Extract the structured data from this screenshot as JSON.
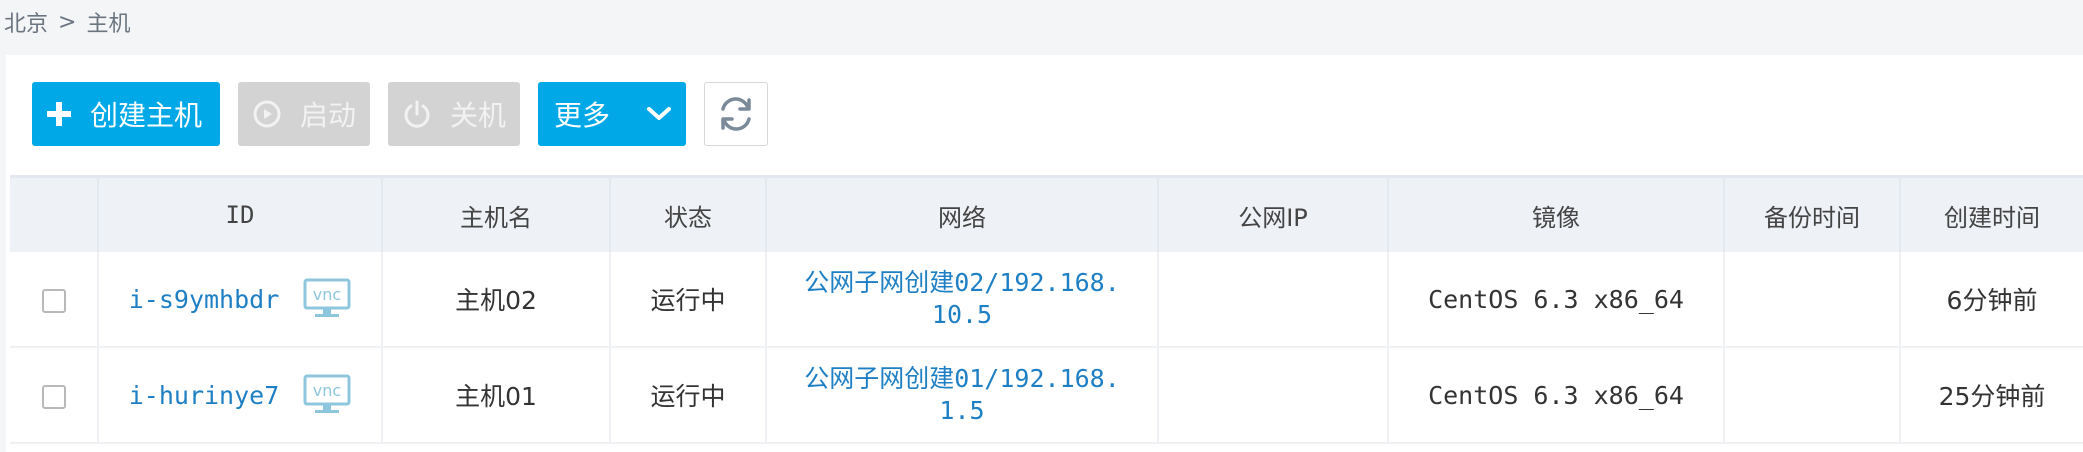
{
  "breadcrumb": {
    "root": "北京",
    "separator": ">",
    "current": "主机"
  },
  "toolbar": {
    "create_label": "创建主机",
    "start_label": "启动",
    "shutdown_label": "关机",
    "more_label": "更多",
    "icons": [
      "plus-icon",
      "play-circle-icon",
      "power-icon",
      "chevron-down-icon",
      "refresh-icon"
    ]
  },
  "colors": {
    "primary": "#00a8e8",
    "disabled": "#d3d3d3",
    "link": "#1f7fc4",
    "vnc": "#8ec7dd"
  },
  "table": {
    "headers": {
      "id": "ID",
      "hostname": "主机名",
      "status": "状态",
      "network": "网络",
      "public_ip": "公网IP",
      "image": "镜像",
      "backup_time": "备份时间",
      "created_time": "创建时间"
    },
    "rows": [
      {
        "id": "i-s9ymhbdr",
        "vnc": "vnc",
        "hostname": "主机02",
        "status": "运行中",
        "network": "公网子网创建02/192.168.10.5",
        "public_ip": "",
        "image": "CentOS 6.3 x86_64",
        "backup_time": "",
        "created_time": "6分钟前"
      },
      {
        "id": "i-hurinye7",
        "vnc": "vnc",
        "hostname": "主机01",
        "status": "运行中",
        "network": "公网子网创建01/192.168.1.5",
        "public_ip": "",
        "image": "CentOS 6.3 x86_64",
        "backup_time": "",
        "created_time": "25分钟前"
      }
    ]
  }
}
